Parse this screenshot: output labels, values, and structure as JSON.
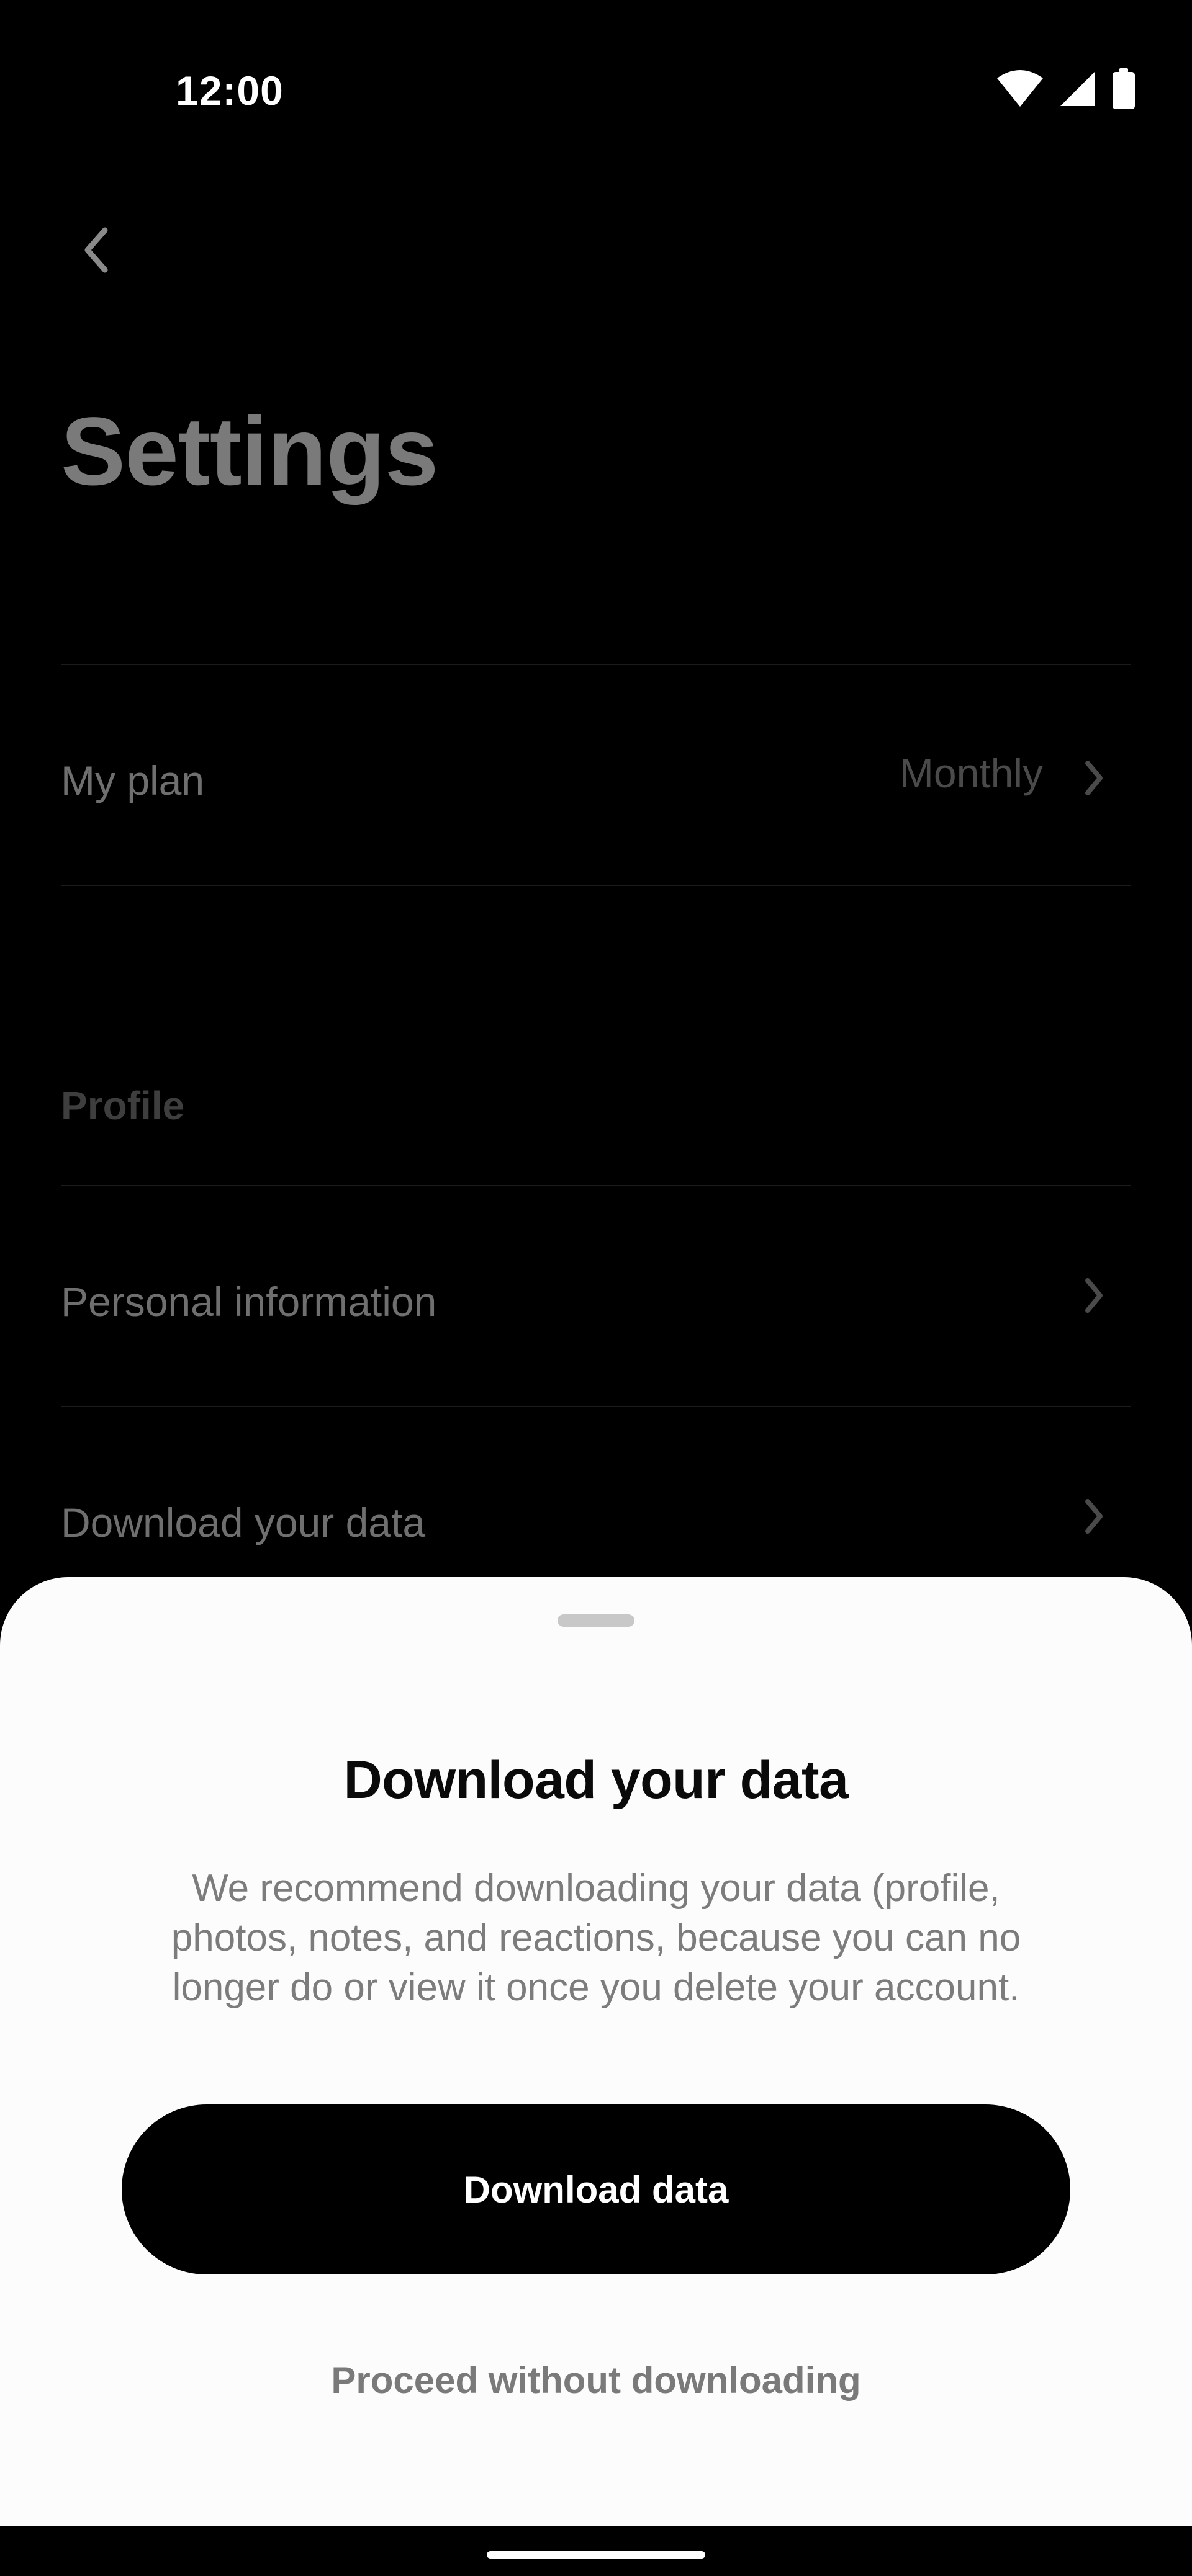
{
  "status_bar": {
    "time": "12:00",
    "icons": [
      "wifi-icon",
      "cellular-signal-icon",
      "battery-icon"
    ]
  },
  "header": {
    "back_icon": "chevron-left-icon",
    "title": "Settings"
  },
  "settings": {
    "plan_row": {
      "label": "My plan",
      "value": "Monthly",
      "icon": "chevron-right-icon"
    },
    "profile_section": {
      "header": "Profile",
      "items": [
        {
          "label": "Personal information",
          "icon": "chevron-right-icon"
        },
        {
          "label": "Download your data",
          "icon": "chevron-right-icon"
        }
      ]
    }
  },
  "sheet": {
    "title": "Download your data",
    "body": "We recommend downloading your data (profile, photos, notes, and reactions, because you can no longer do or view it once you delete your account.",
    "primary_button": "Download data",
    "secondary_button": "Proceed without downloading"
  },
  "colors": {
    "background": "#000000",
    "sheet_background": "#fcfcfc",
    "primary_button": "#000000",
    "dimmed_text": "#6f6f6f"
  }
}
